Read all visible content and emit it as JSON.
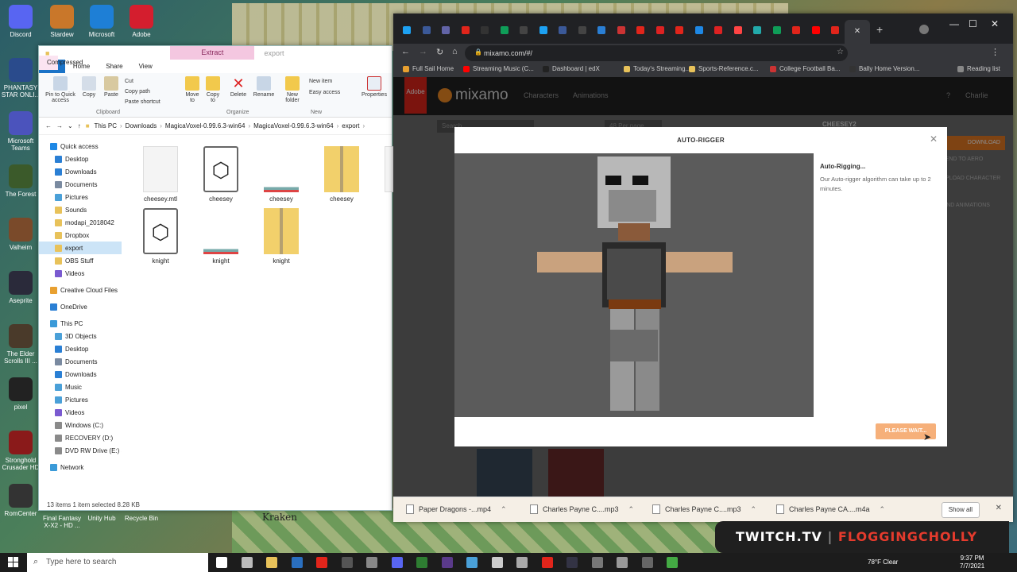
{
  "desktop": {
    "icons": [
      {
        "label": "Discord",
        "color": "#5865f2",
        "glyph": "discord-icon"
      },
      {
        "label": "PHANTASY STAR ONLI...",
        "color": "#2a4b8c",
        "glyph": "game-icon"
      },
      {
        "label": "Microsoft Teams",
        "color": "#4b53bc",
        "glyph": "teams-icon"
      },
      {
        "label": "The Forest",
        "color": "#3b5a2a",
        "glyph": "forest-icon"
      },
      {
        "label": "Valheim",
        "color": "#7a4a2a",
        "glyph": "valheim-icon"
      },
      {
        "label": "Aseprite",
        "color": "#2a2a3a",
        "glyph": "aseprite-icon"
      },
      {
        "label": "The Elder Scrolls III ...",
        "color": "#4a3a2a",
        "glyph": "elder-scrolls-icon"
      },
      {
        "label": "pixel",
        "color": "#222222",
        "glyph": "unity-icon"
      },
      {
        "label": "Stronghold Crusader HD",
        "color": "#8a1a1a",
        "glyph": "shield-icon"
      },
      {
        "label": "RomCenter",
        "color": "#333333",
        "glyph": "romcenter-icon"
      }
    ],
    "top_icons": [
      {
        "label": "Stardew",
        "color": "#c9772a"
      },
      {
        "label": "Microsoft",
        "color": "#1e7fd6"
      },
      {
        "label": "Adobe",
        "color": "#d41e2e"
      }
    ],
    "bottom_icons": [
      {
        "label": "Final Fantasy X-X2 - HD ..."
      },
      {
        "label": "Unity Hub"
      },
      {
        "label": "Recycle Bin"
      }
    ],
    "wallpaper_text": "Kraken"
  },
  "explorer": {
    "context_tab": "Extract",
    "window_name": "export",
    "tabs": [
      "File",
      "Home",
      "Share",
      "View",
      "Compressed Folder Tools"
    ],
    "ribbon": {
      "pin": "Pin to Quick access",
      "copy": "Copy",
      "paste": "Paste",
      "cut": "Cut",
      "copy_path": "Copy path",
      "paste_shortcut": "Paste shortcut",
      "move_to": "Move to",
      "copy_to": "Copy to",
      "delete": "Delete",
      "rename": "Rename",
      "new_folder": "New folder",
      "new_item": "New item",
      "easy_access": "Easy access",
      "properties": "Properties",
      "groups": [
        "Clipboard",
        "Organize",
        "New"
      ]
    },
    "breadcrumbs": [
      "This PC",
      "Downloads",
      "MagicaVoxel-0.99.6.3-win64",
      "MagicaVoxel-0.99.6.3-win64",
      "export"
    ],
    "nav": [
      {
        "label": "Quick access",
        "indent": 0,
        "color": "#1e88e5"
      },
      {
        "label": "Desktop",
        "indent": 1,
        "color": "#2a7fd4"
      },
      {
        "label": "Downloads",
        "indent": 1,
        "color": "#2a7fd4"
      },
      {
        "label": "Documents",
        "indent": 1,
        "color": "#7a8aa0"
      },
      {
        "label": "Pictures",
        "indent": 1,
        "color": "#4aa0d8"
      },
      {
        "label": "Sounds",
        "indent": 1,
        "color": "#e8c25a"
      },
      {
        "label": "modapi_2018042",
        "indent": 1,
        "color": "#e8c25a"
      },
      {
        "label": "Dropbox",
        "indent": 1,
        "color": "#e8c25a"
      },
      {
        "label": "export",
        "indent": 1,
        "color": "#e8c25a"
      },
      {
        "label": "OBS Stuff",
        "indent": 1,
        "color": "#e8c25a"
      },
      {
        "label": "Videos",
        "indent": 1,
        "color": "#7a5ad0"
      },
      {
        "label": "Creative Cloud Files",
        "indent": 0,
        "color": "#e8a030"
      },
      {
        "label": "OneDrive",
        "indent": 0,
        "color": "#2a7fd4"
      },
      {
        "label": "This PC",
        "indent": 0,
        "color": "#3a9ad8"
      },
      {
        "label": "3D Objects",
        "indent": 1,
        "color": "#4aa0d8"
      },
      {
        "label": "Desktop",
        "indent": 1,
        "color": "#2a7fd4"
      },
      {
        "label": "Documents",
        "indent": 1,
        "color": "#7a8aa0"
      },
      {
        "label": "Downloads",
        "indent": 1,
        "color": "#2a7fd4"
      },
      {
        "label": "Music",
        "indent": 1,
        "color": "#4aa0d8"
      },
      {
        "label": "Pictures",
        "indent": 1,
        "color": "#4aa0d8"
      },
      {
        "label": "Videos",
        "indent": 1,
        "color": "#7a5ad0"
      },
      {
        "label": "Windows (C:)",
        "indent": 1,
        "color": "#8a8a8a"
      },
      {
        "label": "RECOVERY (D:)",
        "indent": 1,
        "color": "#8a8a8a"
      },
      {
        "label": "DVD RW Drive (E:) S",
        "indent": 1,
        "color": "#8a8a8a"
      },
      {
        "label": "Network",
        "indent": 0,
        "color": "#3a9ad8"
      }
    ],
    "files": [
      {
        "name": "cheesey.mtl",
        "kind": "doc"
      },
      {
        "name": "cheesey",
        "kind": "3d"
      },
      {
        "name": "cheesey",
        "kind": "img"
      },
      {
        "name": "cheesey",
        "kind": "zip"
      },
      {
        "name": "chee",
        "kind": "doc"
      },
      {
        "name": "knight",
        "kind": "3d"
      },
      {
        "name": "knight",
        "kind": "img"
      },
      {
        "name": "knight",
        "kind": "zip"
      }
    ],
    "status": "13 items     1 item selected  8.28 KB"
  },
  "chrome": {
    "url": "mixamo.com/#/",
    "new_tab": "+",
    "bookmarks": [
      "Full Sail Home",
      "Streaming Music (C...",
      "Dashboard | edX",
      "Today's Streaming...",
      "Sports-Reference.c...",
      "College Football Ba...",
      "Bally Home Version...",
      "Reading list"
    ],
    "mixamo": {
      "logo": "mixamo",
      "adobe": "Adobe",
      "nav": [
        "Characters",
        "Animations"
      ],
      "user": "Charlie",
      "character_name": "CHEESEY2",
      "search_placeholder": "Search",
      "per_page": "48 Per page",
      "side_buttons": [
        "DOWNLOAD",
        "SEND TO AERO",
        "UPLOAD CHARACTER",
        "FIND ANIMATIONS"
      ]
    },
    "modal": {
      "title": "AUTO-RIGGER",
      "heading": "Auto-Rigging...",
      "body": "Our Auto-rigger algorithm can take up to 2 minutes.",
      "button": "PLEASE WAIT..."
    },
    "downloads": [
      "Paper Dragons -...mp4",
      "Charles Payne C....mp3",
      "Charles Payne C....mp3",
      "Charles Payne CA....m4a"
    ],
    "show_all": "Show all"
  },
  "twitch": {
    "prefix": "TWITCH.TV",
    "channel": "FLOGGINGCHOLLY"
  },
  "taskbar": {
    "search_placeholder": "Type here to search",
    "weather": "78°F  Clear",
    "time": "9:37 PM",
    "date": "7/7/2021"
  }
}
